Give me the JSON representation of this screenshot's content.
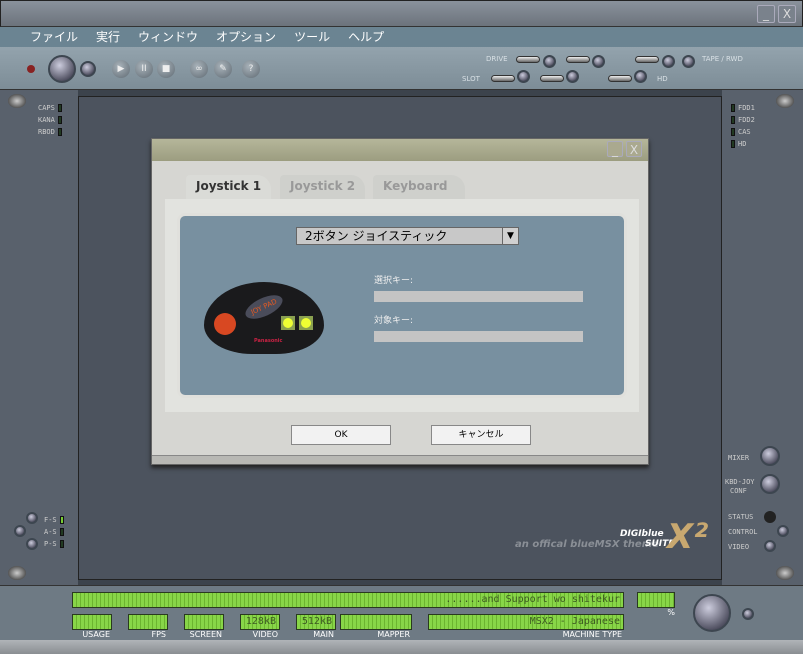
{
  "window": {
    "minimize": "_",
    "close": "X"
  },
  "menu": [
    "ファイル",
    "実行",
    "ウィンドウ",
    "オプション",
    "ツール",
    "ヘルプ"
  ],
  "toolbar": {
    "drive_label": "DRIVE",
    "slot_label": "SLOT",
    "tape_label": "TAPE / RWD",
    "hd_label": "HD",
    "play": "▶",
    "pause": "II",
    "stop": "■",
    "help": "?"
  },
  "left_leds": [
    {
      "label": "CAPS",
      "on": false
    },
    {
      "label": "KANA",
      "on": false
    },
    {
      "label": "RBOD",
      "on": false
    }
  ],
  "right_leds": [
    {
      "label": "FDD1",
      "on": false
    },
    {
      "label": "FDD2",
      "on": false
    },
    {
      "label": "CAS",
      "on": false
    },
    {
      "label": "HD",
      "on": false
    }
  ],
  "left_bottom_leds": [
    {
      "label": "F-S",
      "on": true
    },
    {
      "label": "A-S",
      "on": false
    },
    {
      "label": "P-S",
      "on": false
    }
  ],
  "right_controls": {
    "mixer": "MIXER",
    "kbd_joy": "KBD-JOY",
    "conf": "CONF",
    "status": "STATUS",
    "control": "CONTROL",
    "video": "VIDEO"
  },
  "branding": {
    "tagline": "an offical blueMSX theme",
    "digi": "DIGIblue",
    "suite": "SUITE",
    "x2": "X²"
  },
  "dialog": {
    "minimize": "_",
    "close": "X",
    "tabs": [
      {
        "label": "Joystick 1",
        "active": true
      },
      {
        "label": "Joystick 2",
        "active": false
      },
      {
        "label": "Keyboard",
        "active": false
      }
    ],
    "device_select": "2ボタン ジョイスティック",
    "select_key_label": "選択キー:",
    "select_key_value": "",
    "target_key_label": "対象キー:",
    "target_key_value": "",
    "joypad_brand": "Panasonic",
    "joypad_name": "JOY PAD",
    "ok": "OK",
    "cancel": "キャンセル"
  },
  "status": {
    "message": "......and Support wo shitekur",
    "usage": {
      "label": "USAGE",
      "value": ""
    },
    "fps": {
      "label": "FPS",
      "value": ""
    },
    "screen": {
      "label": "SCREEN",
      "value": ""
    },
    "video": {
      "label": "VIDEO",
      "value": "128kB"
    },
    "main": {
      "label": "MAIN",
      "value": "512kB"
    },
    "mapper": {
      "label": "MAPPER",
      "value": ""
    },
    "machine": {
      "label": "MACHINE TYPE",
      "value": "MSX2 - Japanese"
    },
    "percent": {
      "label": "%",
      "value": ""
    }
  }
}
